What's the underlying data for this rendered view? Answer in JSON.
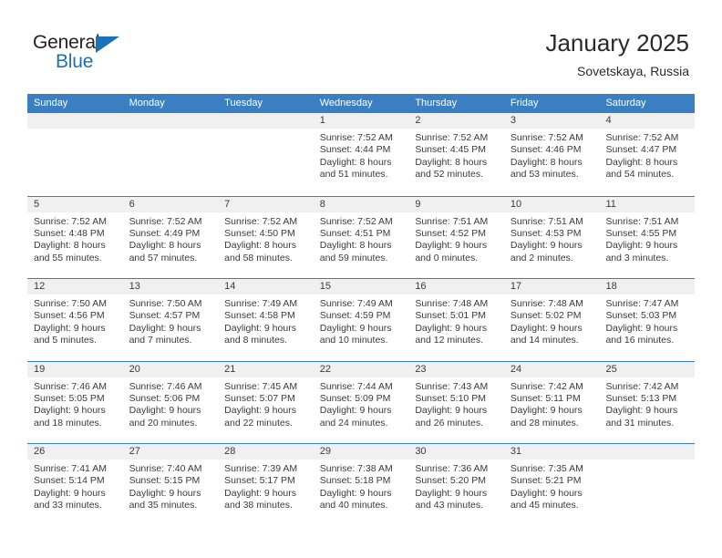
{
  "brand": {
    "word_one": "General",
    "word_two": "Blue",
    "triangle_color": "#1b72b8"
  },
  "header": {
    "title": "January 2025",
    "location": "Sovetskaya, Russia"
  },
  "theme": {
    "header_blue": "#3a7fc1",
    "date_strip_gray": "#f0f0f0",
    "text_color": "#3a3a3a"
  },
  "weekday_headers": [
    "Sunday",
    "Monday",
    "Tuesday",
    "Wednesday",
    "Thursday",
    "Friday",
    "Saturday"
  ],
  "weeks": [
    [
      {
        "day": "",
        "sunrise": "",
        "sunset": "",
        "daylight_line1": "",
        "daylight_line2": "",
        "empty": true
      },
      {
        "day": "",
        "sunrise": "",
        "sunset": "",
        "daylight_line1": "",
        "daylight_line2": "",
        "empty": true
      },
      {
        "day": "",
        "sunrise": "",
        "sunset": "",
        "daylight_line1": "",
        "daylight_line2": "",
        "empty": true
      },
      {
        "day": "1",
        "sunrise": "Sunrise: 7:52 AM",
        "sunset": "Sunset: 4:44 PM",
        "daylight_line1": "Daylight: 8 hours",
        "daylight_line2": "and 51 minutes."
      },
      {
        "day": "2",
        "sunrise": "Sunrise: 7:52 AM",
        "sunset": "Sunset: 4:45 PM",
        "daylight_line1": "Daylight: 8 hours",
        "daylight_line2": "and 52 minutes."
      },
      {
        "day": "3",
        "sunrise": "Sunrise: 7:52 AM",
        "sunset": "Sunset: 4:46 PM",
        "daylight_line1": "Daylight: 8 hours",
        "daylight_line2": "and 53 minutes."
      },
      {
        "day": "4",
        "sunrise": "Sunrise: 7:52 AM",
        "sunset": "Sunset: 4:47 PM",
        "daylight_line1": "Daylight: 8 hours",
        "daylight_line2": "and 54 minutes."
      }
    ],
    [
      {
        "day": "5",
        "sunrise": "Sunrise: 7:52 AM",
        "sunset": "Sunset: 4:48 PM",
        "daylight_line1": "Daylight: 8 hours",
        "daylight_line2": "and 55 minutes."
      },
      {
        "day": "6",
        "sunrise": "Sunrise: 7:52 AM",
        "sunset": "Sunset: 4:49 PM",
        "daylight_line1": "Daylight: 8 hours",
        "daylight_line2": "and 57 minutes."
      },
      {
        "day": "7",
        "sunrise": "Sunrise: 7:52 AM",
        "sunset": "Sunset: 4:50 PM",
        "daylight_line1": "Daylight: 8 hours",
        "daylight_line2": "and 58 minutes."
      },
      {
        "day": "8",
        "sunrise": "Sunrise: 7:52 AM",
        "sunset": "Sunset: 4:51 PM",
        "daylight_line1": "Daylight: 8 hours",
        "daylight_line2": "and 59 minutes."
      },
      {
        "day": "9",
        "sunrise": "Sunrise: 7:51 AM",
        "sunset": "Sunset: 4:52 PM",
        "daylight_line1": "Daylight: 9 hours",
        "daylight_line2": "and 0 minutes."
      },
      {
        "day": "10",
        "sunrise": "Sunrise: 7:51 AM",
        "sunset": "Sunset: 4:53 PM",
        "daylight_line1": "Daylight: 9 hours",
        "daylight_line2": "and 2 minutes."
      },
      {
        "day": "11",
        "sunrise": "Sunrise: 7:51 AM",
        "sunset": "Sunset: 4:55 PM",
        "daylight_line1": "Daylight: 9 hours",
        "daylight_line2": "and 3 minutes."
      }
    ],
    [
      {
        "day": "12",
        "sunrise": "Sunrise: 7:50 AM",
        "sunset": "Sunset: 4:56 PM",
        "daylight_line1": "Daylight: 9 hours",
        "daylight_line2": "and 5 minutes."
      },
      {
        "day": "13",
        "sunrise": "Sunrise: 7:50 AM",
        "sunset": "Sunset: 4:57 PM",
        "daylight_line1": "Daylight: 9 hours",
        "daylight_line2": "and 7 minutes."
      },
      {
        "day": "14",
        "sunrise": "Sunrise: 7:49 AM",
        "sunset": "Sunset: 4:58 PM",
        "daylight_line1": "Daylight: 9 hours",
        "daylight_line2": "and 8 minutes."
      },
      {
        "day": "15",
        "sunrise": "Sunrise: 7:49 AM",
        "sunset": "Sunset: 4:59 PM",
        "daylight_line1": "Daylight: 9 hours",
        "daylight_line2": "and 10 minutes."
      },
      {
        "day": "16",
        "sunrise": "Sunrise: 7:48 AM",
        "sunset": "Sunset: 5:01 PM",
        "daylight_line1": "Daylight: 9 hours",
        "daylight_line2": "and 12 minutes."
      },
      {
        "day": "17",
        "sunrise": "Sunrise: 7:48 AM",
        "sunset": "Sunset: 5:02 PM",
        "daylight_line1": "Daylight: 9 hours",
        "daylight_line2": "and 14 minutes."
      },
      {
        "day": "18",
        "sunrise": "Sunrise: 7:47 AM",
        "sunset": "Sunset: 5:03 PM",
        "daylight_line1": "Daylight: 9 hours",
        "daylight_line2": "and 16 minutes."
      }
    ],
    [
      {
        "day": "19",
        "sunrise": "Sunrise: 7:46 AM",
        "sunset": "Sunset: 5:05 PM",
        "daylight_line1": "Daylight: 9 hours",
        "daylight_line2": "and 18 minutes."
      },
      {
        "day": "20",
        "sunrise": "Sunrise: 7:46 AM",
        "sunset": "Sunset: 5:06 PM",
        "daylight_line1": "Daylight: 9 hours",
        "daylight_line2": "and 20 minutes."
      },
      {
        "day": "21",
        "sunrise": "Sunrise: 7:45 AM",
        "sunset": "Sunset: 5:07 PM",
        "daylight_line1": "Daylight: 9 hours",
        "daylight_line2": "and 22 minutes."
      },
      {
        "day": "22",
        "sunrise": "Sunrise: 7:44 AM",
        "sunset": "Sunset: 5:09 PM",
        "daylight_line1": "Daylight: 9 hours",
        "daylight_line2": "and 24 minutes."
      },
      {
        "day": "23",
        "sunrise": "Sunrise: 7:43 AM",
        "sunset": "Sunset: 5:10 PM",
        "daylight_line1": "Daylight: 9 hours",
        "daylight_line2": "and 26 minutes."
      },
      {
        "day": "24",
        "sunrise": "Sunrise: 7:42 AM",
        "sunset": "Sunset: 5:11 PM",
        "daylight_line1": "Daylight: 9 hours",
        "daylight_line2": "and 28 minutes."
      },
      {
        "day": "25",
        "sunrise": "Sunrise: 7:42 AM",
        "sunset": "Sunset: 5:13 PM",
        "daylight_line1": "Daylight: 9 hours",
        "daylight_line2": "and 31 minutes."
      }
    ],
    [
      {
        "day": "26",
        "sunrise": "Sunrise: 7:41 AM",
        "sunset": "Sunset: 5:14 PM",
        "daylight_line1": "Daylight: 9 hours",
        "daylight_line2": "and 33 minutes."
      },
      {
        "day": "27",
        "sunrise": "Sunrise: 7:40 AM",
        "sunset": "Sunset: 5:15 PM",
        "daylight_line1": "Daylight: 9 hours",
        "daylight_line2": "and 35 minutes."
      },
      {
        "day": "28",
        "sunrise": "Sunrise: 7:39 AM",
        "sunset": "Sunset: 5:17 PM",
        "daylight_line1": "Daylight: 9 hours",
        "daylight_line2": "and 38 minutes."
      },
      {
        "day": "29",
        "sunrise": "Sunrise: 7:38 AM",
        "sunset": "Sunset: 5:18 PM",
        "daylight_line1": "Daylight: 9 hours",
        "daylight_line2": "and 40 minutes."
      },
      {
        "day": "30",
        "sunrise": "Sunrise: 7:36 AM",
        "sunset": "Sunset: 5:20 PM",
        "daylight_line1": "Daylight: 9 hours",
        "daylight_line2": "and 43 minutes."
      },
      {
        "day": "31",
        "sunrise": "Sunrise: 7:35 AM",
        "sunset": "Sunset: 5:21 PM",
        "daylight_line1": "Daylight: 9 hours",
        "daylight_line2": "and 45 minutes."
      },
      {
        "day": "",
        "sunrise": "",
        "sunset": "",
        "daylight_line1": "",
        "daylight_line2": "",
        "empty": true
      }
    ]
  ]
}
